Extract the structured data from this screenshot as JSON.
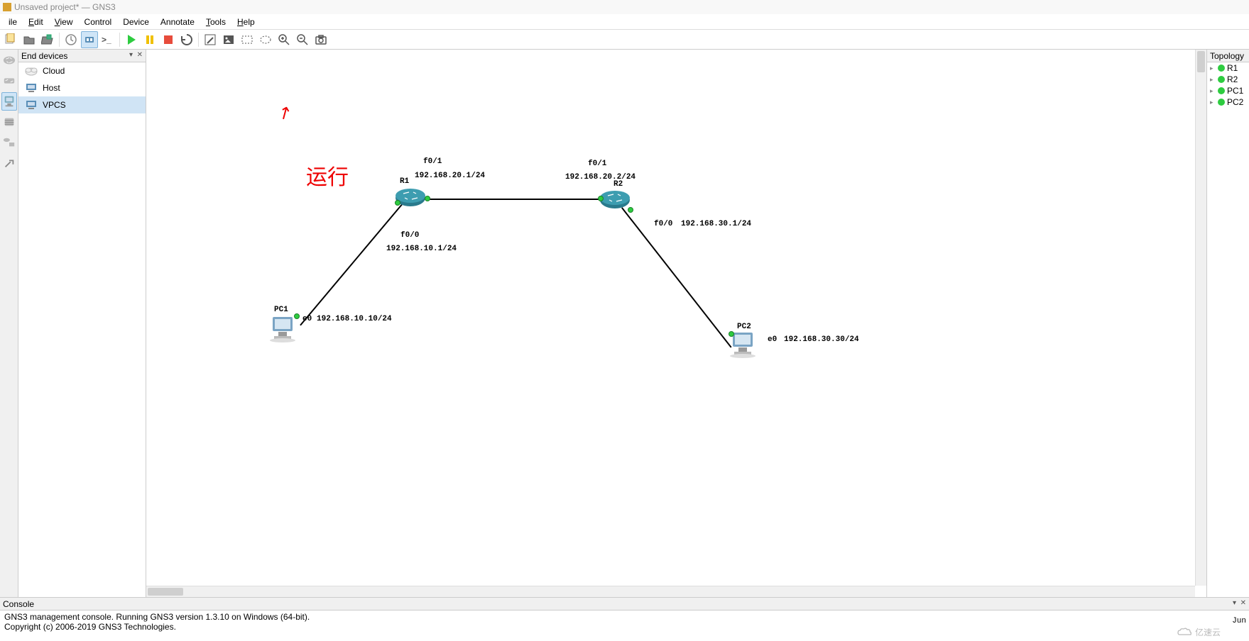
{
  "title": "Unsaved project* — GNS3",
  "menu": {
    "file": "ile",
    "edit": "Edit",
    "view": "View",
    "control": "Control",
    "device": "Device",
    "annotate": "Annotate",
    "tools": "Tools",
    "help": "Help"
  },
  "devicePanel": {
    "title": "End devices",
    "items": [
      {
        "name": "Cloud"
      },
      {
        "name": "Host"
      },
      {
        "name": "VPCS"
      }
    ]
  },
  "annotation": {
    "text": "运行"
  },
  "topology": {
    "title": "Topology",
    "nodes": [
      "R1",
      "R2",
      "PC1",
      "PC2"
    ]
  },
  "canvas": {
    "R1": {
      "label": "R1",
      "ports": {
        "f01": "f0/1",
        "f00": "f0/0"
      },
      "ip_f01": "192.168.20.1/24",
      "ip_f00": "192.168.10.1/24"
    },
    "R2": {
      "label": "R2",
      "ports": {
        "f01": "f0/1",
        "f00": "f0/0"
      },
      "ip_f01": "192.168.20.2/24",
      "ip_f00": "192.168.30.1/24"
    },
    "PC1": {
      "label": "PC1",
      "port": "e0",
      "ip": "192.168.10.10/24"
    },
    "PC2": {
      "label": "PC2",
      "port": "e0",
      "ip": "192.168.30.30/24"
    }
  },
  "console": {
    "title": "Console",
    "line1": "GNS3 management console. Running GNS3 version 1.3.10 on Windows (64-bit).",
    "line2": "Copyright (c) 2006-2019 GNS3 Technologies."
  },
  "statusRight": "Jun",
  "watermark": "亿速云"
}
